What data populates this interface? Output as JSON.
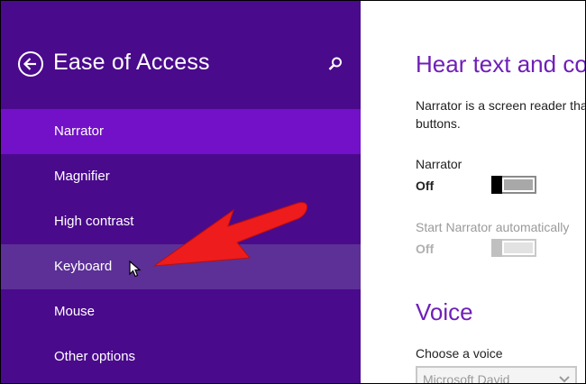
{
  "left_pane": {
    "title": "Ease of Access",
    "back_icon": "back-arrow-circle-icon",
    "search_icon": "search-icon",
    "nav_items": [
      {
        "label": "Narrator",
        "state": "selected"
      },
      {
        "label": "Magnifier",
        "state": "normal"
      },
      {
        "label": "High contrast",
        "state": "normal"
      },
      {
        "label": "Keyboard",
        "state": "hover"
      },
      {
        "label": "Mouse",
        "state": "normal"
      },
      {
        "label": "Other options",
        "state": "normal"
      }
    ]
  },
  "right_pane": {
    "heading": "Hear text and controls",
    "description_line1": "Narrator is a screen reader that",
    "description_line2": "buttons.",
    "narrator": {
      "label": "Narrator",
      "state_text": "Off"
    },
    "start_auto": {
      "label": "Start Narrator automatically",
      "state_text": "Off"
    },
    "voice_heading": "Voice",
    "choose_voice_label": "Choose a voice",
    "voice_value": "Microsoft David"
  },
  "colors": {
    "sidebar_bg": "#4a0a8c",
    "selected_bg": "#7211c7",
    "hover_bg": "#5c3097",
    "accent_text": "#6f1fb8",
    "annotation_arrow": "#ee1c1c"
  }
}
